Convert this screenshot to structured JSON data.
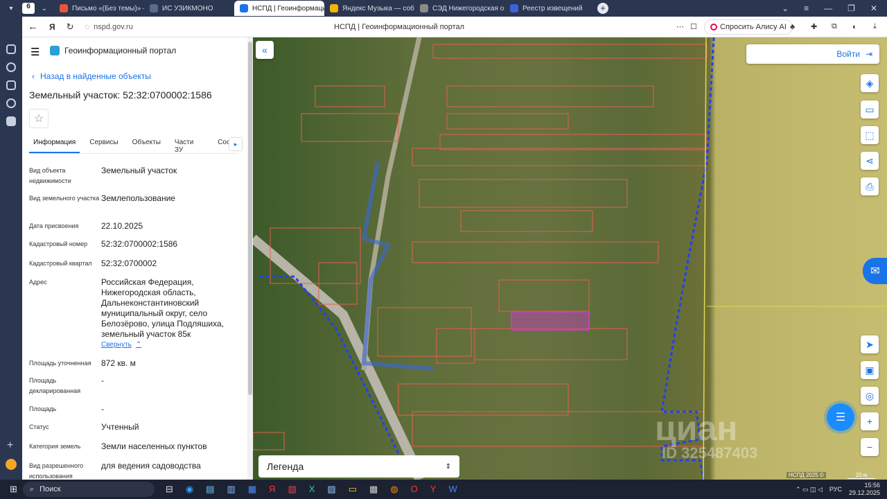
{
  "browser": {
    "tabs": [
      {
        "label": "Письмо «(Без темы)» — П",
        "color": "#e8553b"
      },
      {
        "label": "ИС УЗИКМОНО",
        "color": "#5a6a8a"
      },
      {
        "label": "НСПД | Геоинформаци",
        "color": "#1a73e8",
        "active": true
      },
      {
        "label": "Яндекс Музыка — собира",
        "color": "#f5b400"
      },
      {
        "label": "СЭД Нижегородская обл",
        "color": "#8a8a8a"
      },
      {
        "label": "Реестр извещений",
        "color": "#3b62d6"
      }
    ],
    "tab_count": "6",
    "url": "nspd.gov.ru",
    "page_title": "НСПД | Геоинформационный портал",
    "alice": "Спросить Алису AI"
  },
  "panel": {
    "portal_title": "Геоинформационный портал",
    "back_link": "Назад в найденные объекты",
    "object_title": "Земельный участок: 52:32:0700002:1586",
    "tabs": [
      "Информация",
      "Сервисы",
      "Объекты",
      "Части ЗУ",
      "Соста"
    ],
    "fields": [
      {
        "key": "Вид объекта недвижимости",
        "value": "Земельный участок"
      },
      {
        "key": "Вид земельного участка",
        "value": "Землепользование"
      },
      {
        "key": "Дата присвоения",
        "value": "22.10.2025"
      },
      {
        "key": "Кадастровый номер",
        "value": "52:32:0700002:1586"
      },
      {
        "key": "Кадастровый квартал",
        "value": "52:32:0700002"
      },
      {
        "key": "Адрес",
        "value": "Российская Федерация, Нижегородская область, Дальнеконстантиновский муниципальный округ, село Белозёрово, улица Подляшиха, земельный участок 85к"
      },
      {
        "key": "Площадь уточненная",
        "value": "872 кв. м"
      },
      {
        "key": "Площадь декларированная",
        "value": "-"
      },
      {
        "key": "Площадь",
        "value": "-"
      },
      {
        "key": "Статус",
        "value": "Учтенный"
      },
      {
        "key": "Категория земель",
        "value": "Земли населенных пунктов"
      },
      {
        "key": "Вид разрешенного использования",
        "value": "для ведения садоводства"
      }
    ],
    "collapse_link": "Свернуть"
  },
  "map": {
    "login": "Войти",
    "legend": "Легенда",
    "copyright": "НСПД 2025 ©",
    "scale": "20 м",
    "watermark": "циан",
    "watermark_id": "ID 325487403",
    "parcel_highlight_color": "#c43fbf"
  },
  "taskbar": {
    "search": "Поиск",
    "lang": "РУС",
    "time": "15:56",
    "date": "29.12.2025"
  }
}
